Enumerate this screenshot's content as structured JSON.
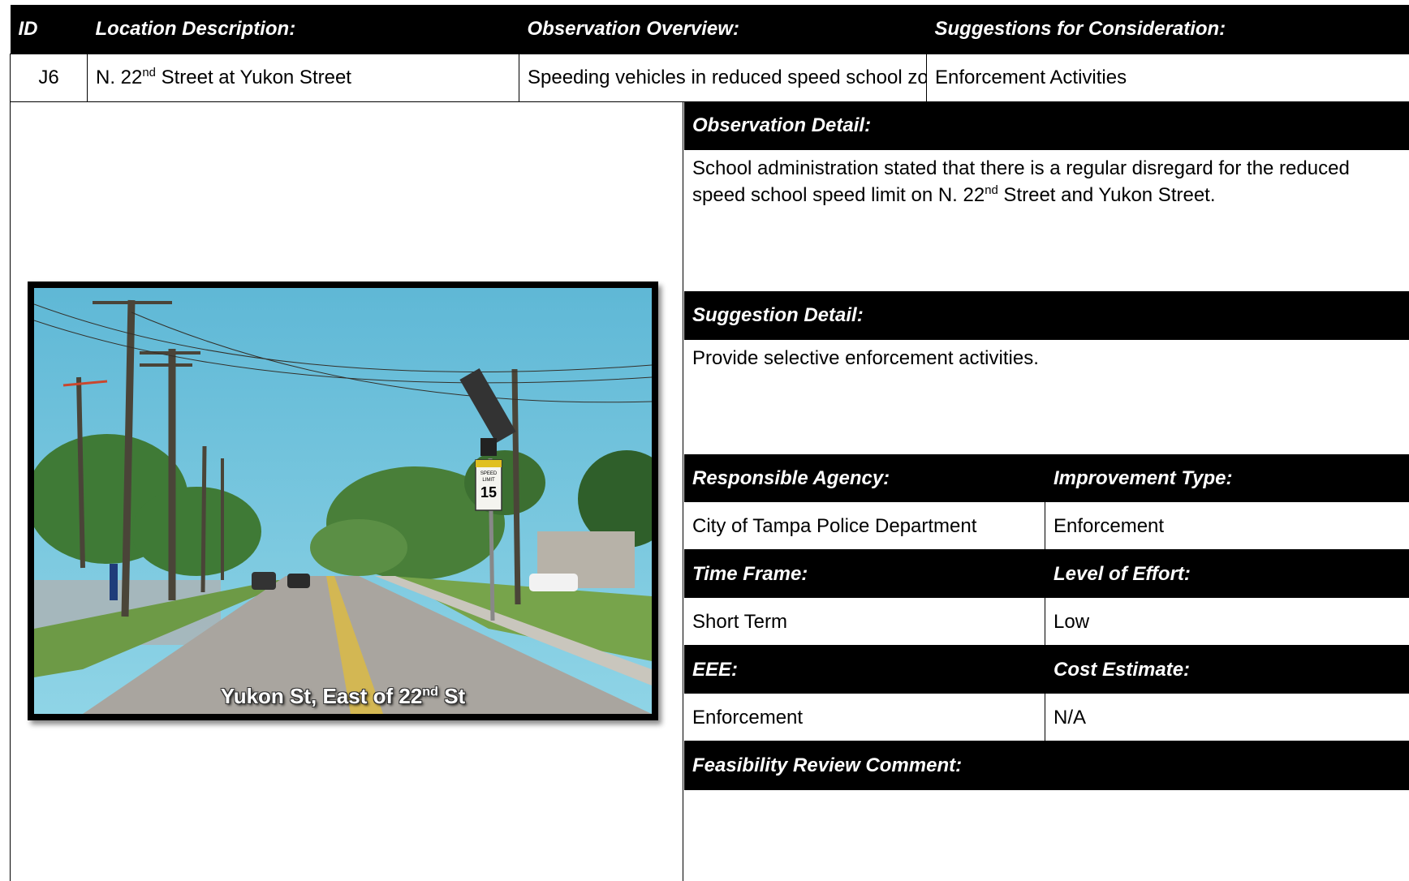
{
  "header": {
    "id_label": "ID",
    "location_label": "Location Description:",
    "overview_label": "Observation Overview:",
    "suggestions_label": "Suggestions for Consideration:"
  },
  "row": {
    "id": "J6",
    "location_pre": "N. 22",
    "location_sup": "nd",
    "location_post": " Street at Yukon Street",
    "overview": "Speeding vehicles in reduced speed school zone",
    "suggestions": "Enforcement Activities"
  },
  "photo": {
    "caption_pre": "Yukon St, East of 22",
    "caption_sup": "nd",
    "caption_post": " St",
    "sign_top": "SPEED",
    "sign_mid": "LIMIT",
    "sign_speed": "15"
  },
  "observation_detail": {
    "label": "Observation Detail:",
    "text_pre": "School administration stated that there is a regular disregard for the reduced speed school speed limit on N. 22",
    "text_sup": "nd",
    "text_post": " Street and Yukon Street."
  },
  "suggestion_detail": {
    "label": "Suggestion Detail:",
    "text": "Provide selective enforcement activities."
  },
  "details": {
    "responsible_agency_label": "Responsible Agency:",
    "responsible_agency": "City of Tampa Police Department",
    "improvement_type_label": "Improvement Type:",
    "improvement_type": "Enforcement",
    "time_frame_label": "Time Frame:",
    "time_frame": "Short Term",
    "level_of_effort_label": "Level of Effort:",
    "level_of_effort": "Low",
    "eee_label": "EEE:",
    "eee": "Enforcement",
    "cost_estimate_label": "Cost Estimate:",
    "cost_estimate": "N/A"
  },
  "feasibility": {
    "label": "Feasibility Review Comment:",
    "text": ""
  }
}
